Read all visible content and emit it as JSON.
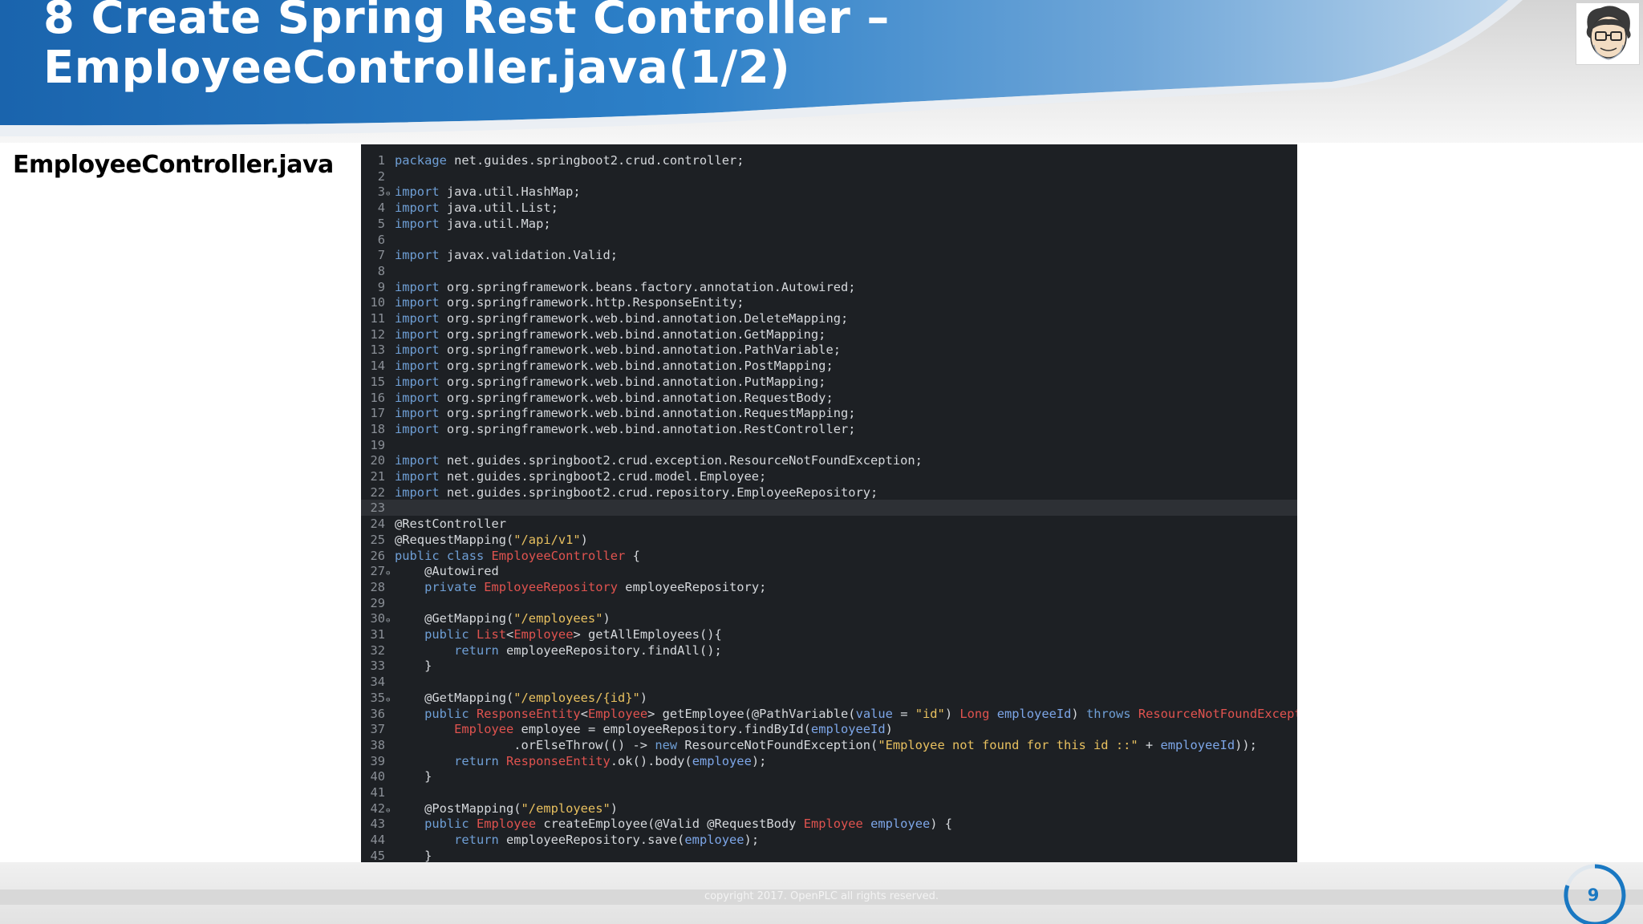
{
  "slide": {
    "title_line1": "8 Create Spring Rest Controller –",
    "title_line2": "EmployeeController.java(1/2)",
    "file_label": "EmployeeController.java",
    "copyright": "copyright 2017. OpenPLC all rights reserved.",
    "page_number": "9"
  },
  "colors": {
    "header_blue": "#1c6fb8",
    "code_background": "#1d2024",
    "keyword": "#6f9fd6",
    "string": "#e8c05f",
    "type": "#e0534f",
    "page_number": "#1a78c2"
  },
  "code": {
    "highlighted_line": 23,
    "lines": [
      {
        "n": "1",
        "fold": false,
        "segs": [
          [
            "kw",
            "package"
          ],
          [
            "p",
            " net.guides.springboot2.crud.controller;"
          ]
        ]
      },
      {
        "n": "2",
        "fold": false,
        "segs": []
      },
      {
        "n": "3",
        "fold": true,
        "segs": [
          [
            "kw",
            "import"
          ],
          [
            "p",
            " java.util.HashMap;"
          ]
        ]
      },
      {
        "n": "4",
        "fold": false,
        "segs": [
          [
            "kw",
            "import"
          ],
          [
            "p",
            " java.util.List;"
          ]
        ]
      },
      {
        "n": "5",
        "fold": false,
        "segs": [
          [
            "kw",
            "import"
          ],
          [
            "p",
            " java.util.Map;"
          ]
        ]
      },
      {
        "n": "6",
        "fold": false,
        "segs": []
      },
      {
        "n": "7",
        "fold": false,
        "segs": [
          [
            "kw",
            "import"
          ],
          [
            "p",
            " javax.validation.Valid;"
          ]
        ]
      },
      {
        "n": "8",
        "fold": false,
        "segs": []
      },
      {
        "n": "9",
        "fold": false,
        "segs": [
          [
            "kw",
            "import"
          ],
          [
            "p",
            " org.springframework.beans.factory.annotation.Autowired;"
          ]
        ]
      },
      {
        "n": "10",
        "fold": false,
        "segs": [
          [
            "kw",
            "import"
          ],
          [
            "p",
            " org.springframework.http.ResponseEntity;"
          ]
        ]
      },
      {
        "n": "11",
        "fold": false,
        "segs": [
          [
            "kw",
            "import"
          ],
          [
            "p",
            " org.springframework.web.bind.annotation.DeleteMapping;"
          ]
        ]
      },
      {
        "n": "12",
        "fold": false,
        "segs": [
          [
            "kw",
            "import"
          ],
          [
            "p",
            " org.springframework.web.bind.annotation.GetMapping;"
          ]
        ]
      },
      {
        "n": "13",
        "fold": false,
        "segs": [
          [
            "kw",
            "import"
          ],
          [
            "p",
            " org.springframework.web.bind.annotation.PathVariable;"
          ]
        ]
      },
      {
        "n": "14",
        "fold": false,
        "segs": [
          [
            "kw",
            "import"
          ],
          [
            "p",
            " org.springframework.web.bind.annotation.PostMapping;"
          ]
        ]
      },
      {
        "n": "15",
        "fold": false,
        "segs": [
          [
            "kw",
            "import"
          ],
          [
            "p",
            " org.springframework.web.bind.annotation.PutMapping;"
          ]
        ]
      },
      {
        "n": "16",
        "fold": false,
        "segs": [
          [
            "kw",
            "import"
          ],
          [
            "p",
            " org.springframework.web.bind.annotation.RequestBody;"
          ]
        ]
      },
      {
        "n": "17",
        "fold": false,
        "segs": [
          [
            "kw",
            "import"
          ],
          [
            "p",
            " org.springframework.web.bind.annotation.RequestMapping;"
          ]
        ]
      },
      {
        "n": "18",
        "fold": false,
        "segs": [
          [
            "kw",
            "import"
          ],
          [
            "p",
            " org.springframework.web.bind.annotation.RestController;"
          ]
        ]
      },
      {
        "n": "19",
        "fold": false,
        "segs": []
      },
      {
        "n": "20",
        "fold": false,
        "segs": [
          [
            "kw",
            "import"
          ],
          [
            "p",
            " net.guides.springboot2.crud.exception.ResourceNotFoundException;"
          ]
        ]
      },
      {
        "n": "21",
        "fold": false,
        "segs": [
          [
            "kw",
            "import"
          ],
          [
            "p",
            " net.guides.springboot2.crud.model.Employee;"
          ]
        ]
      },
      {
        "n": "22",
        "fold": false,
        "segs": [
          [
            "kw",
            "import"
          ],
          [
            "p",
            " net.guides.springboot2.crud.repository.EmployeeRepository;"
          ]
        ]
      },
      {
        "n": "23",
        "fold": false,
        "segs": []
      },
      {
        "n": "24",
        "fold": false,
        "segs": [
          [
            "p",
            "@RestController"
          ]
        ]
      },
      {
        "n": "25",
        "fold": false,
        "segs": [
          [
            "p",
            "@RequestMapping("
          ],
          [
            "str",
            "\"/api/v1\""
          ],
          [
            "p",
            ")"
          ]
        ]
      },
      {
        "n": "26",
        "fold": false,
        "segs": [
          [
            "kw",
            "public"
          ],
          [
            "p",
            " "
          ],
          [
            "kw",
            "class"
          ],
          [
            "p",
            " "
          ],
          [
            "typ",
            "EmployeeController"
          ],
          [
            "p",
            " {"
          ]
        ]
      },
      {
        "n": "27",
        "fold": true,
        "segs": [
          [
            "p",
            "    @Autowired"
          ]
        ]
      },
      {
        "n": "28",
        "fold": false,
        "segs": [
          [
            "p",
            "    "
          ],
          [
            "kw",
            "private"
          ],
          [
            "p",
            " "
          ],
          [
            "typ",
            "EmployeeRepository"
          ],
          [
            "p",
            " employeeRepository;"
          ]
        ]
      },
      {
        "n": "29",
        "fold": false,
        "segs": []
      },
      {
        "n": "30",
        "fold": true,
        "segs": [
          [
            "p",
            "    @GetMapping("
          ],
          [
            "str",
            "\"/employees\""
          ],
          [
            "p",
            ")"
          ]
        ]
      },
      {
        "n": "31",
        "fold": false,
        "segs": [
          [
            "p",
            "    "
          ],
          [
            "kw",
            "public"
          ],
          [
            "p",
            " "
          ],
          [
            "typ",
            "List"
          ],
          [
            "p",
            "<"
          ],
          [
            "typ",
            "Employee"
          ],
          [
            "p",
            "> getAllEmployees(){"
          ]
        ]
      },
      {
        "n": "32",
        "fold": false,
        "segs": [
          [
            "p",
            "        "
          ],
          [
            "kw",
            "return"
          ],
          [
            "p",
            " employeeRepository.findAll();"
          ]
        ]
      },
      {
        "n": "33",
        "fold": false,
        "segs": [
          [
            "p",
            "    }"
          ]
        ]
      },
      {
        "n": "34",
        "fold": false,
        "segs": []
      },
      {
        "n": "35",
        "fold": true,
        "segs": [
          [
            "p",
            "    @GetMapping("
          ],
          [
            "str",
            "\"/employees/{id}\""
          ],
          [
            "p",
            ")"
          ]
        ]
      },
      {
        "n": "36",
        "fold": false,
        "segs": [
          [
            "p",
            "    "
          ],
          [
            "kw",
            "public"
          ],
          [
            "p",
            " "
          ],
          [
            "typ",
            "ResponseEntity"
          ],
          [
            "p",
            "<"
          ],
          [
            "typ",
            "Employee"
          ],
          [
            "p",
            "> getEmployee(@PathVariable("
          ],
          [
            "var",
            "value"
          ],
          [
            "p",
            " = "
          ],
          [
            "str",
            "\"id\""
          ],
          [
            "p",
            ") "
          ],
          [
            "typ",
            "Long"
          ],
          [
            "p",
            " "
          ],
          [
            "var",
            "employeeId"
          ],
          [
            "p",
            ") "
          ],
          [
            "kw",
            "throws"
          ],
          [
            "p",
            " "
          ],
          [
            "typ",
            "ResourceNotFoundException"
          ],
          [
            "p",
            " {"
          ]
        ]
      },
      {
        "n": "37",
        "fold": false,
        "segs": [
          [
            "p",
            "        "
          ],
          [
            "typ",
            "Employee"
          ],
          [
            "p",
            " employee = employeeRepository.findById("
          ],
          [
            "var",
            "employeeId"
          ],
          [
            "p",
            ")"
          ]
        ]
      },
      {
        "n": "38",
        "fold": false,
        "segs": [
          [
            "p",
            "                .orElseThrow(() -> "
          ],
          [
            "kw",
            "new"
          ],
          [
            "p",
            " ResourceNotFoundException("
          ],
          [
            "str",
            "\"Employee not found for this id ::\""
          ],
          [
            "p",
            " + "
          ],
          [
            "var",
            "employeeId"
          ],
          [
            "p",
            "));"
          ]
        ]
      },
      {
        "n": "39",
        "fold": false,
        "segs": [
          [
            "p",
            "        "
          ],
          [
            "kw",
            "return"
          ],
          [
            "p",
            " "
          ],
          [
            "typ",
            "ResponseEntity"
          ],
          [
            "p",
            ".ok().body("
          ],
          [
            "var",
            "employee"
          ],
          [
            "p",
            ");"
          ]
        ]
      },
      {
        "n": "40",
        "fold": false,
        "segs": [
          [
            "p",
            "    }"
          ]
        ]
      },
      {
        "n": "41",
        "fold": false,
        "segs": []
      },
      {
        "n": "42",
        "fold": true,
        "segs": [
          [
            "p",
            "    @PostMapping("
          ],
          [
            "str",
            "\"/employees\""
          ],
          [
            "p",
            ")"
          ]
        ]
      },
      {
        "n": "43",
        "fold": false,
        "segs": [
          [
            "p",
            "    "
          ],
          [
            "kw",
            "public"
          ],
          [
            "p",
            " "
          ],
          [
            "typ",
            "Employee"
          ],
          [
            "p",
            " createEmployee(@Valid @RequestBody "
          ],
          [
            "typ",
            "Employee"
          ],
          [
            "p",
            " "
          ],
          [
            "var",
            "employee"
          ],
          [
            "p",
            ") {"
          ]
        ]
      },
      {
        "n": "44",
        "fold": false,
        "segs": [
          [
            "p",
            "        "
          ],
          [
            "kw",
            "return"
          ],
          [
            "p",
            " employeeRepository.save("
          ],
          [
            "var",
            "employee"
          ],
          [
            "p",
            ");"
          ]
        ]
      },
      {
        "n": "45",
        "fold": false,
        "segs": [
          [
            "p",
            "    }"
          ]
        ]
      }
    ]
  }
}
